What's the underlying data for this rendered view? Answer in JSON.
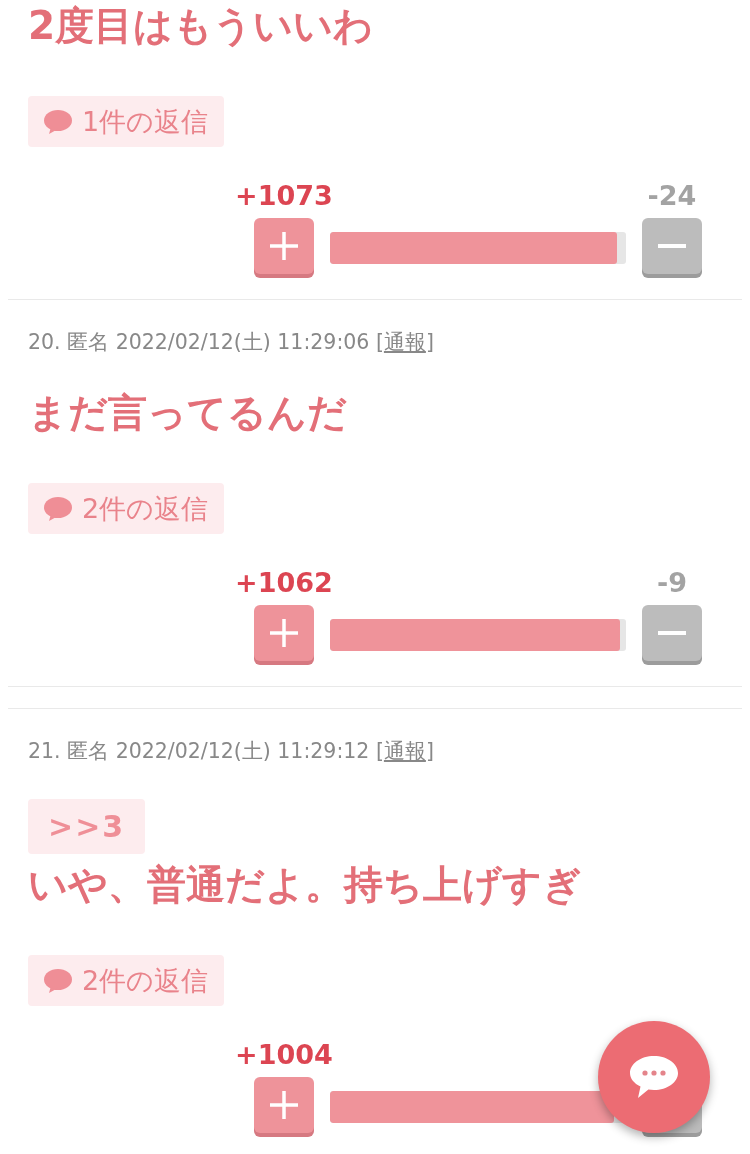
{
  "comments": [
    {
      "body": "2度目はもういいわ",
      "replies": "1件の返信",
      "votes": {
        "plus": "+1073",
        "minus": "-24",
        "level": 0.97
      }
    },
    {
      "meta": {
        "text": "20. 匿名 2022/02/12(土) 11:29:06 [",
        "link": "通報",
        "end": "]"
      },
      "body": "まだ言ってるんだ",
      "replies": "2件の返信",
      "votes": {
        "plus": "+1062",
        "minus": "-9",
        "level": 0.98
      }
    },
    {
      "meta": {
        "text": "21. 匿名 2022/02/12(土) 11:29:12 [",
        "link": "通報",
        "end": "]"
      },
      "anchor": ">>3",
      "body": "いや、普通だよ。持ち上げすぎ",
      "replies": "2件の返信",
      "votes": {
        "plus": "+1004",
        "level": 0.96
      }
    }
  ]
}
